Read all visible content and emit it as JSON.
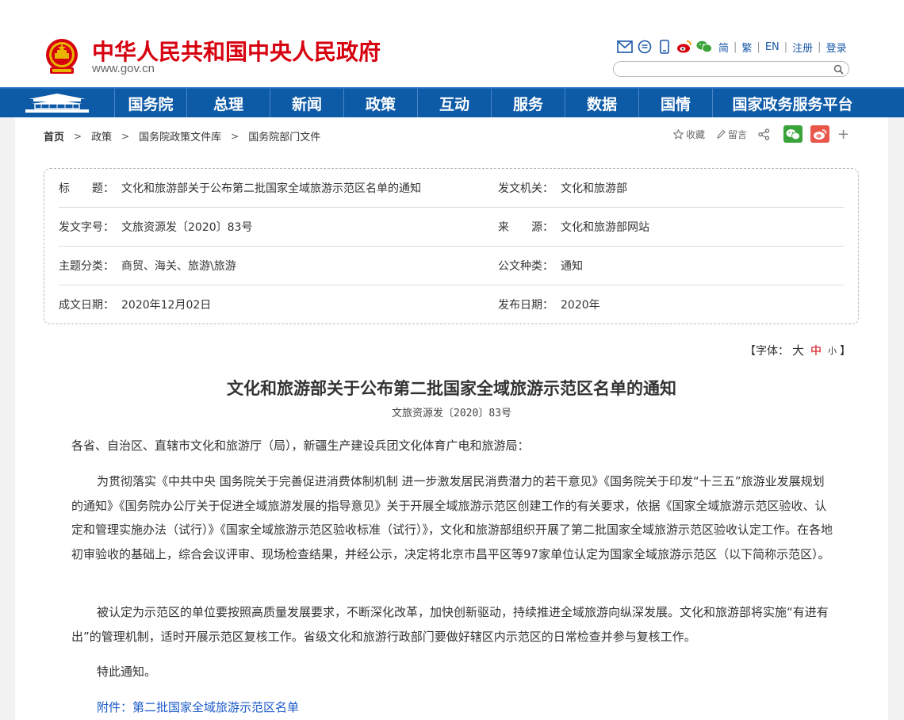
{
  "header": {
    "site_title": "中华人民共和国中央人民政府",
    "site_url": "www.gov.cn",
    "icons": [
      "mail-icon",
      "feed-icon",
      "mobile-icon",
      "weibo-icon",
      "wechat-icon"
    ],
    "lang_links": {
      "simplified": "简",
      "traditional": "繁",
      "english": "EN",
      "register": "注册",
      "login": "登录",
      "separator": "|"
    },
    "search": {
      "placeholder": ""
    }
  },
  "nav": {
    "items": [
      {
        "label": "国务院"
      },
      {
        "label": "总理"
      },
      {
        "label": "新闻"
      },
      {
        "label": "政策"
      },
      {
        "label": "互动"
      },
      {
        "label": "服务"
      },
      {
        "label": "数据"
      },
      {
        "label": "国情"
      },
      {
        "label": "国家政务服务平台"
      }
    ]
  },
  "breadcrumb": {
    "items": [
      "首页",
      "政策",
      "国务院政策文件库",
      "国务院部门文件"
    ],
    "separator": ">"
  },
  "share": {
    "favorite": "收藏",
    "comment": "留言",
    "plus": "+"
  },
  "info": {
    "title_label": "标　　题：",
    "title_value": "文化和旅游部关于公布第二批国家全域旅游示范区名单的通知",
    "issuer_label": "发文机关：",
    "issuer_value": "文化和旅游部",
    "docno_label": "发文字号：",
    "docno_value": "文旅资源发〔2020〕83号",
    "source_label": "来　　源：",
    "source_value": "文化和旅游部网站",
    "topic_label": "主题分类：",
    "topic_value": "商贸、海关、旅游\\旅游",
    "doctype_label": "公文种类：",
    "doctype_value": "通知",
    "date_label": "成文日期：",
    "date_value": "2020年12月02日",
    "pubdate_label": "发布日期：",
    "pubdate_value": "2020年"
  },
  "font_size": {
    "prefix": "【字体：",
    "big": "大",
    "mid": "中",
    "small": "小",
    "suffix": "】"
  },
  "article": {
    "title": "文化和旅游部关于公布第二批国家全域旅游示范区名单的通知",
    "docno": "文旅资源发〔2020〕83号",
    "addressee": "各省、自治区、直辖市文化和旅游厅（局），新疆生产建设兵团文化体育广电和旅游局：",
    "p1": "为贯彻落实《中共中央 国务院关于完善促进消费体制机制 进一步激发居民消费潜力的若干意见》《国务院关于印发“十三五”旅游业发展规划的通知》《国务院办公厅关于促进全域旅游发展的指导意见》关于开展全域旅游示范区创建工作的有关要求，依据《国家全域旅游示范区验收、认定和管理实施办法（试行）》《国家全域旅游示范区验收标准（试行）》，文化和旅游部组织开展了第二批国家全域旅游示范区验收认定工作。在各地初审验收的基础上，综合会议评审、现场检查结果，并经公示，决定将北京市昌平区等97家单位认定为国家全域旅游示范区（以下简称示范区）。",
    "p2": "被认定为示范区的单位要按照高质量发展要求，不断深化改革，加快创新驱动，持续推进全域旅游向纵深发展。文化和旅游部将实施“有进有出”的管理机制，适时开展示范区复核工作。省级文化和旅游行政部门要做好辖区内示范区的日常检查并参与复核工作。",
    "p3": "特此通知。",
    "attachment": "附件：第二批国家全域旅游示范区名单"
  },
  "colors": {
    "brand_red": "#d7000f",
    "nav_blue": "#0d5aa7",
    "link_blue": "#1a58c8"
  }
}
